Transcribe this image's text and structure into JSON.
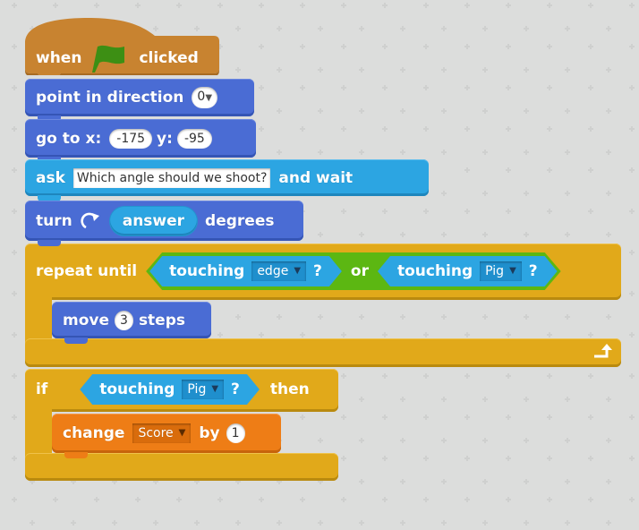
{
  "colors": {
    "background": "#dcdddc",
    "events": "#c88330",
    "motion": "#4a6cd4",
    "sensing": "#2ca5e2",
    "control": "#e1a91a",
    "operators": "#5cb712",
    "data": "#ee7d16",
    "flag": "#3d8f14"
  },
  "script": {
    "hat": {
      "when": "when",
      "icon": "green-flag-icon",
      "clicked": "clicked"
    },
    "point_direction": {
      "label": "point in direction",
      "value": "0"
    },
    "goto": {
      "label": "go to x:",
      "x": "-175",
      "y_label": "y:",
      "y": "-95"
    },
    "ask": {
      "label": "ask",
      "question": "Which angle should we shoot?",
      "suffix": "and wait"
    },
    "turn": {
      "label": "turn",
      "icon": "rotate-clockwise-icon",
      "reporter": "answer",
      "suffix": "degrees"
    },
    "repeat_until": {
      "label": "repeat until",
      "cond_left": {
        "label": "touching",
        "target": "edge",
        "q": "?"
      },
      "operator": "or",
      "cond_right": {
        "label": "touching",
        "target": "Pig",
        "q": "?"
      },
      "body": {
        "move_label": "move",
        "steps": "3",
        "steps_label": "steps"
      },
      "loop_icon": "loop-arrow-icon"
    },
    "if_block": {
      "label": "if",
      "cond": {
        "label": "touching",
        "target": "Pig",
        "q": "?"
      },
      "then": "then",
      "body": {
        "change_label": "change",
        "variable": "Score",
        "by_label": "by",
        "amount": "1"
      }
    }
  }
}
